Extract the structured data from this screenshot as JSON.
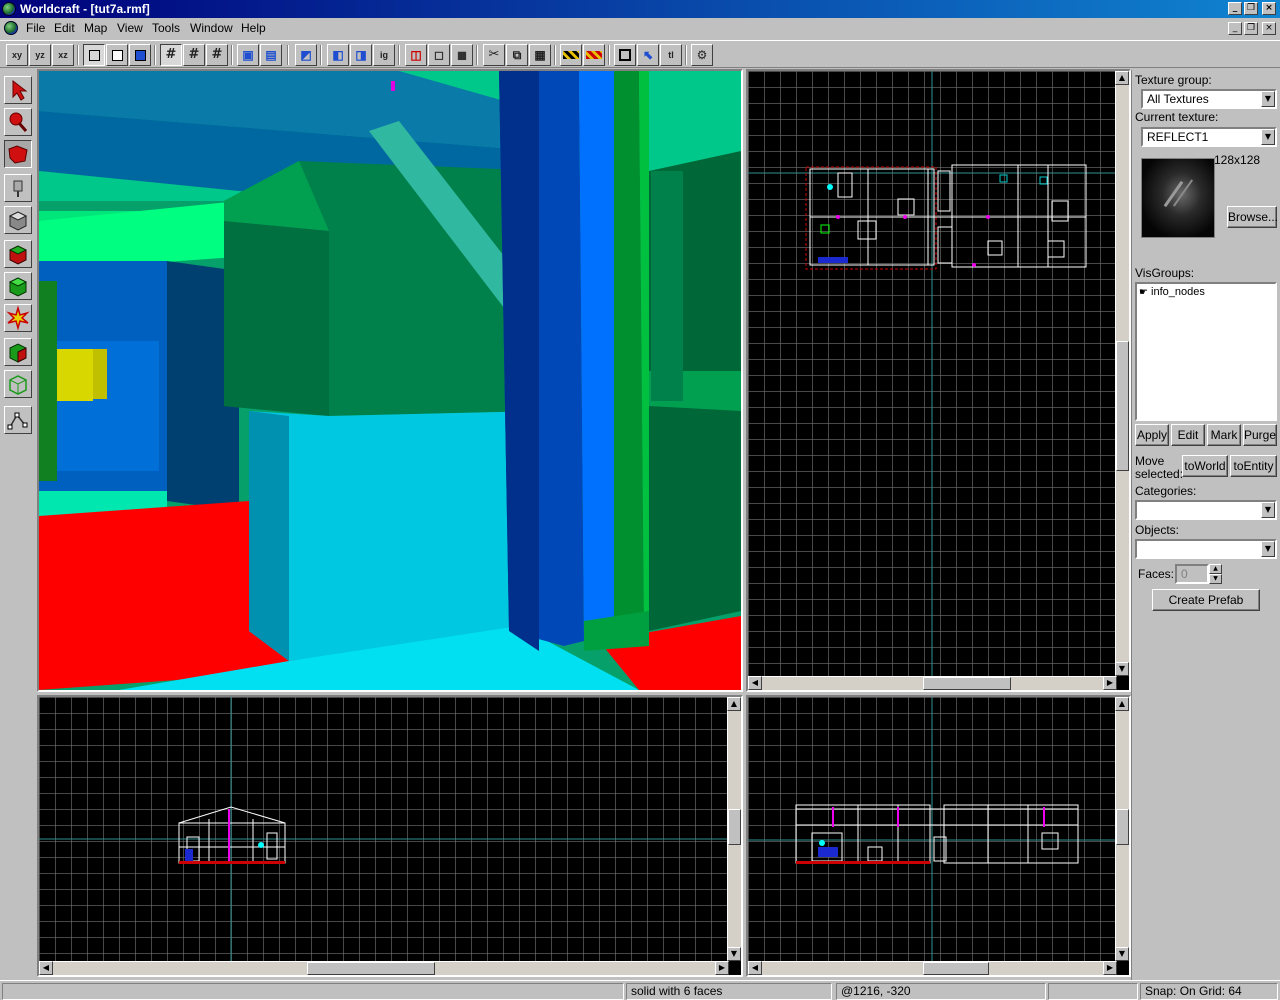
{
  "window": {
    "title": "Worldcraft - [tut7a.rmf]",
    "min": "_",
    "restore": "❐",
    "close": "×"
  },
  "menu": [
    "File",
    "Edit",
    "Map",
    "View",
    "Tools",
    "Window",
    "Help"
  ],
  "toolbar": {
    "view_buttons": [
      "xy",
      "yz",
      "xz"
    ],
    "other_buttons": [
      "ig",
      "tl"
    ]
  },
  "right_panel": {
    "texture_group_label": "Texture group:",
    "texture_group_value": "All Textures",
    "current_texture_label": "Current texture:",
    "current_texture_value": "REFLECT1",
    "texture_size": "128x128",
    "browse_label": "Browse...",
    "visgroups_label": "VisGroups:",
    "visgroups": [
      "info_nodes"
    ],
    "apply_label": "Apply",
    "edit_label": "Edit",
    "mark_label": "Mark",
    "purge_label": "Purge",
    "move_selected_label_1": "Move",
    "move_selected_label_2": "selected:",
    "to_world_label": "toWorld",
    "to_entity_label": "toEntity",
    "categories_label": "Categories:",
    "categories_value": "",
    "objects_label": "Objects:",
    "objects_value": "",
    "faces_label": "Faces:",
    "faces_value": "0",
    "create_prefab_label": "Create Prefab"
  },
  "status": {
    "selection": "solid with 6 faces",
    "coords": "@1216, -320",
    "snap": "Snap: On Grid: 64"
  },
  "colors": {
    "title_start": "#00007b",
    "title_end": "#1084d0",
    "chrome": "#c0c0c0",
    "viewport_bg": "#000000"
  }
}
